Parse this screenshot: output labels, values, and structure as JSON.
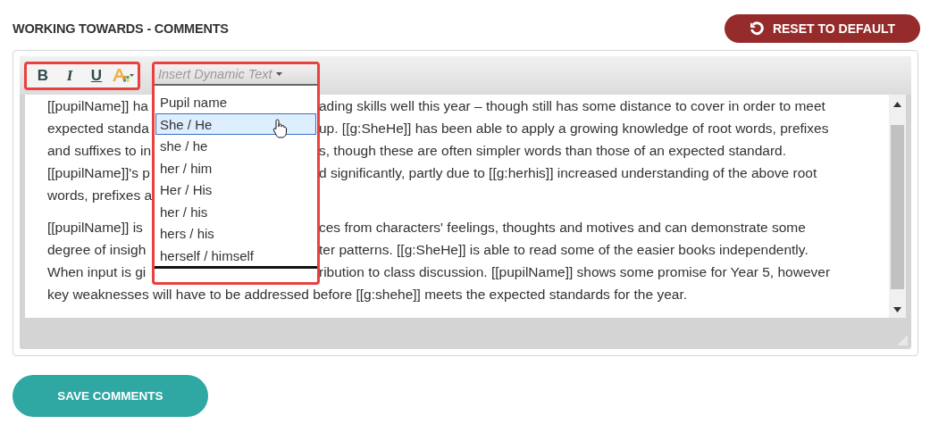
{
  "header": {
    "title": "WORKING TOWARDS - COMMENTS",
    "reset_button": "RESET TO DEFAULT"
  },
  "toolbar": {
    "format_buttons": [
      {
        "kind": "bold",
        "label": "B"
      },
      {
        "kind": "italic",
        "label": "I"
      },
      {
        "kind": "underline",
        "label": "U"
      }
    ]
  },
  "dynamic_text": {
    "label": "Insert Dynamic Text",
    "expanded": true,
    "options": [
      {
        "label": "Pupil name",
        "selected": false
      },
      {
        "label": "She / He",
        "selected": true
      },
      {
        "label": "she / he",
        "selected": false
      },
      {
        "label": "her / him",
        "selected": false
      },
      {
        "label": "Her / His",
        "selected": false
      },
      {
        "label": "her / his",
        "selected": false
      },
      {
        "label": "hers / his",
        "selected": false
      },
      {
        "label": "herself / himself",
        "selected": false
      }
    ]
  },
  "editor": {
    "paragraphs": [
      {
        "lines": [
          {
            "left": "[[pupilName]] ha",
            "right": "ading skills well this year – though still has some distance to cover in order to meet"
          },
          {
            "left": "expected standa",
            "right": "up. [[g:SheHe]] has been able to apply a growing knowledge of root words, prefixes"
          },
          {
            "left": "and suffixes to in",
            "right": "s, though these are often simpler words than those of an expected standard."
          },
          {
            "left": "[[pupilName]]'s p",
            "right": "d significantly, partly due to [[g:herhis]] increased understanding of the above root"
          },
          {
            "left": "words, prefixes a"
          }
        ]
      },
      {
        "lines": [
          {
            "left": "[[pupilName]] is",
            "right": "ces from characters' feelings, thoughts and motives and can demonstrate some"
          },
          {
            "left": "degree of insigh",
            "right": "ter patterns. [[g:SheHe]] is able to read some of the easier books independently."
          },
          {
            "left": "When input is gi",
            "right": "ribution to class discussion. [[pupilName]] shows some promise for Year 5, however"
          },
          {
            "full": "key weaknesses will have to be addressed before [[g:shehe]] meets the expected standards for the year."
          }
        ]
      }
    ]
  },
  "save_button": "SAVE COMMENTS"
}
